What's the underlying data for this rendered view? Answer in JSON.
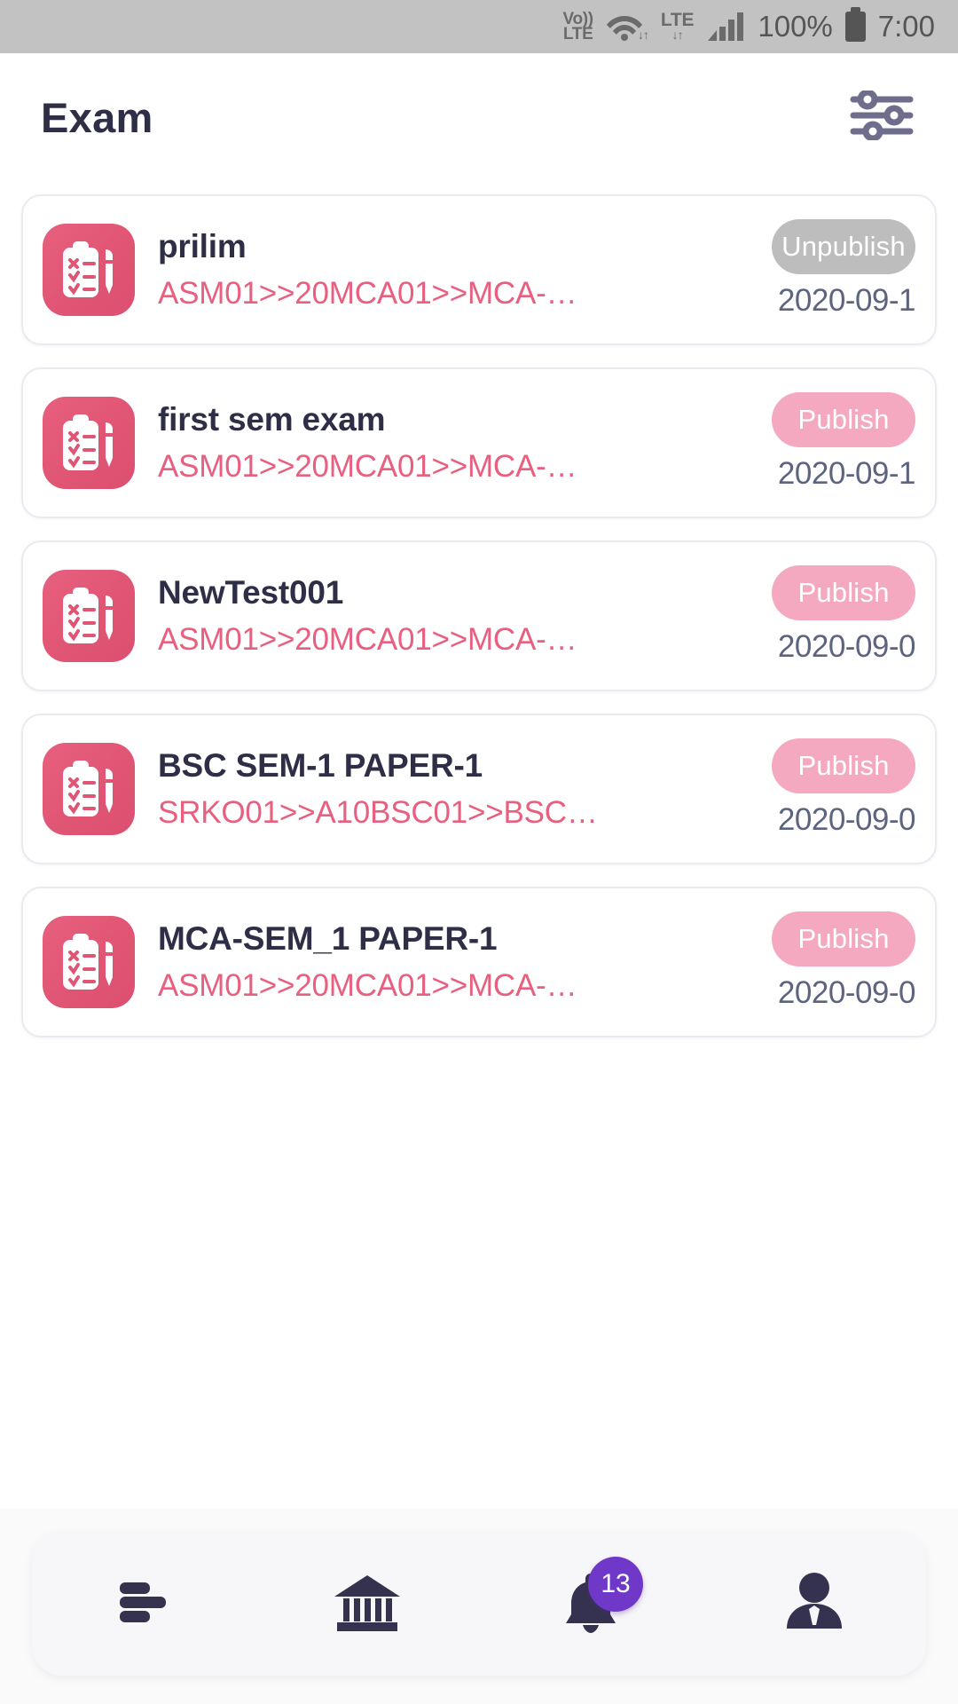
{
  "status_bar": {
    "volte_line1": "Vo))",
    "volte_line2": "LTE",
    "wifi_icon": "wifi-icon",
    "wifi_arrows": "↓↑",
    "lte_label": "LTE",
    "lte_arrows": "↓↑",
    "signal_icon": "signal-bars-icon",
    "battery_percent": "100%",
    "battery_icon": "battery-full-icon",
    "time": "7:00"
  },
  "header": {
    "title": "Exam",
    "filter_icon": "filter-sliders-icon"
  },
  "colors": {
    "accent_pink": "#e8607f",
    "badge_publish": "#f5a9c0",
    "badge_unpublish": "#bdbdbd",
    "title_dark": "#2e2e47",
    "date_gray": "#5d6480",
    "nav_badge_purple": "#7038c8",
    "status_bar_gray": "#c2c2c2"
  },
  "exams": [
    {
      "icon": "clipboard-checklist-icon",
      "title": "prilim",
      "path": "ASM01>>20MCA01>>MCA-…",
      "status": "Unpublish",
      "status_type": "unpublish",
      "date": "2020-09-1"
    },
    {
      "icon": "clipboard-checklist-icon",
      "title": "first sem exam",
      "path": "ASM01>>20MCA01>>MCA-…",
      "status": "Publish",
      "status_type": "publish",
      "date": "2020-09-1"
    },
    {
      "icon": "clipboard-checklist-icon",
      "title": "NewTest001",
      "path": "ASM01>>20MCA01>>MCA-…",
      "status": "Publish",
      "status_type": "publish",
      "date": "2020-09-0"
    },
    {
      "icon": "clipboard-checklist-icon",
      "title": "BSC SEM-1 PAPER-1",
      "path": "SRKO01>>A10BSC01>>BSC…",
      "status": "Publish",
      "status_type": "publish",
      "date": "2020-09-0"
    },
    {
      "icon": "clipboard-checklist-icon",
      "title": "MCA-SEM_1 PAPER-1",
      "path": "ASM01>>20MCA01>>MCA-…",
      "status": "Publish",
      "status_type": "publish",
      "date": "2020-09-0"
    }
  ],
  "bottom_nav": {
    "items": [
      {
        "icon": "menu-list-icon",
        "badge": null
      },
      {
        "icon": "institution-bank-icon",
        "badge": null
      },
      {
        "icon": "bell-notification-icon",
        "badge": "13"
      },
      {
        "icon": "user-profile-icon",
        "badge": null
      }
    ]
  }
}
